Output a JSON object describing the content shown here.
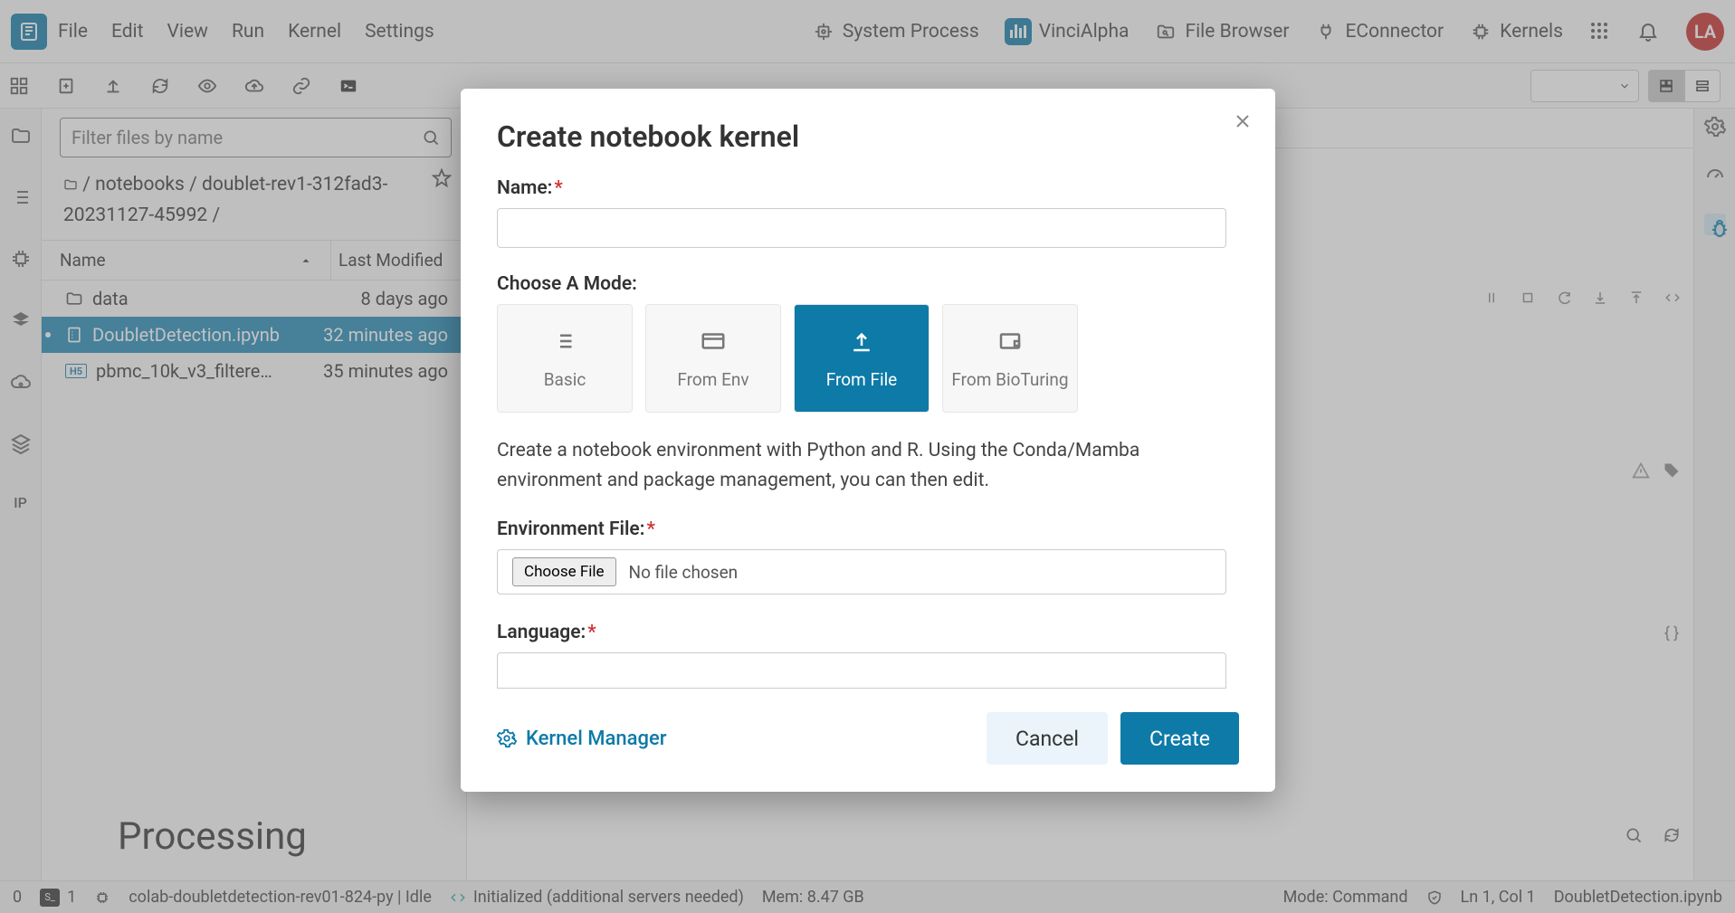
{
  "menubar": {
    "items": [
      "File",
      "Edit",
      "View",
      "Run",
      "Kernel",
      "Settings"
    ],
    "topnav": [
      {
        "label": "System Process"
      },
      {
        "label": "VinciAlpha"
      },
      {
        "label": "File Browser"
      },
      {
        "label": "EConnector"
      },
      {
        "label": "Kernels"
      }
    ],
    "avatar_initials": "LA"
  },
  "filter_placeholder": "Filter files by name",
  "breadcrumb": {
    "line1_a": "notebooks",
    "line1_b": "doublet-rev1-312fad3-",
    "line2": "20231127-45992 /"
  },
  "filecols": {
    "name": "Name",
    "modified": "Last Modified"
  },
  "files": [
    {
      "name": "data",
      "modified": "8 days ago",
      "type": "folder"
    },
    {
      "name": "DoubletDetection.ipynb",
      "modified": "32 minutes ago",
      "type": "nb",
      "selected": true
    },
    {
      "name": "pbmc_10k_v3_filtere…",
      "modified": "35 minutes ago",
      "type": "h5"
    }
  ],
  "rail_ip": "IP",
  "nb_tab": "DoubletDetection.ipynb",
  "nb_processing": "Processing",
  "statusbar": {
    "zero": "0",
    "one": "1",
    "kernel": "colab-doubletdetection-rev01-824-py | Idle",
    "init": "Initialized (additional servers needed)",
    "mem": "Mem: 8.47 GB",
    "mode": "Mode: Command",
    "ln": "Ln 1, Col 1",
    "file": "DoubletDetection.ipynb"
  },
  "modal": {
    "title": "Create notebook kernel",
    "name_label": "Name:",
    "mode_label": "Choose A Mode:",
    "modes": [
      "Basic",
      "From Env",
      "From File",
      "From BioTuring"
    ],
    "active_mode": 2,
    "desc": "Create a notebook environment with Python and R. Using the Conda/Mamba environment and package management, you can then edit.",
    "env_label": "Environment File:",
    "choose_file": "Choose File",
    "no_file": "No file chosen",
    "lang_label": "Language:",
    "km_link": "Kernel Manager",
    "cancel": "Cancel",
    "create": "Create"
  }
}
